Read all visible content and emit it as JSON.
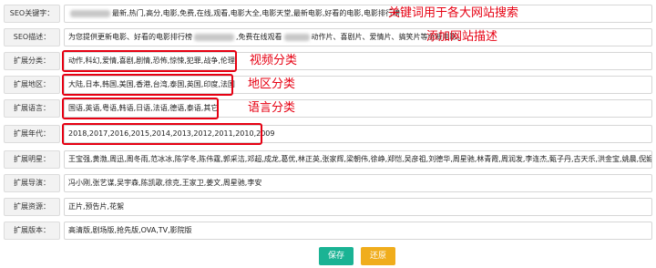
{
  "form": {
    "rows": [
      {
        "label": "SEO关键字：",
        "value_a": "",
        "value_b": "最新,热门,高分,电影,免费,在线,观看,电影大全,电影天堂,最新电影,好看的电影,电影排行榜"
      },
      {
        "label": "SEO描述：",
        "value_a": "为您提供更新电影、好看的电影排行榜",
        "value_b": ",免费在线观看",
        "value_c": "动作片、喜剧片、爱情片、搞笑片等全新电影。"
      },
      {
        "label": "扩展分类：",
        "value": "动作,科幻,爱情,喜剧,剧情,恐怖,惊悚,犯罪,战争,伦理"
      },
      {
        "label": "扩展地区：",
        "value": "大陆,日本,韩国,美国,香港,台湾,泰国,英国,印度,法国"
      },
      {
        "label": "扩展语言：",
        "value": "国语,英语,粤语,韩语,日语,法语,德语,泰语,其它"
      },
      {
        "label": "扩展年代：",
        "value": "2018,2017,2016,2015,2014,2013,2012,2011,2010,2009"
      },
      {
        "label": "扩展明星：",
        "value": "王宝强,黄渤,周迅,周冬雨,范冰冰,陈学冬,陈伟霆,郭采洁,邓超,成龙,葛优,林正英,张家辉,梁朝伟,徐峥,郑恺,吴彦祖,刘德华,周星驰,林青霞,周润发,李连杰,甄子丹,古天乐,洪金宝,姚晨,倪妮,黄晓明,彭于晏"
      },
      {
        "label": "扩展导演：",
        "value": "冯小刚,张艺谋,吴宇森,陈凯歌,徐克,王家卫,姜文,周星驰,李安"
      },
      {
        "label": "扩展资源：",
        "value": "正片,预告片,花絮"
      },
      {
        "label": "扩展版本：",
        "value": "高清版,剧场版,抢先版,OVA,TV,影院版"
      }
    ]
  },
  "annotations": {
    "keywords": "关键词用于各大网站搜索",
    "description": "添加网站描述",
    "category": "视频分类",
    "area": "地区分类",
    "language": "语言分类"
  },
  "buttons": {
    "save": "保存",
    "reset": "还原"
  },
  "colors": {
    "highlight": "#e60012",
    "save_bg": "#1ab394",
    "reset_bg": "#f0ad1c"
  }
}
